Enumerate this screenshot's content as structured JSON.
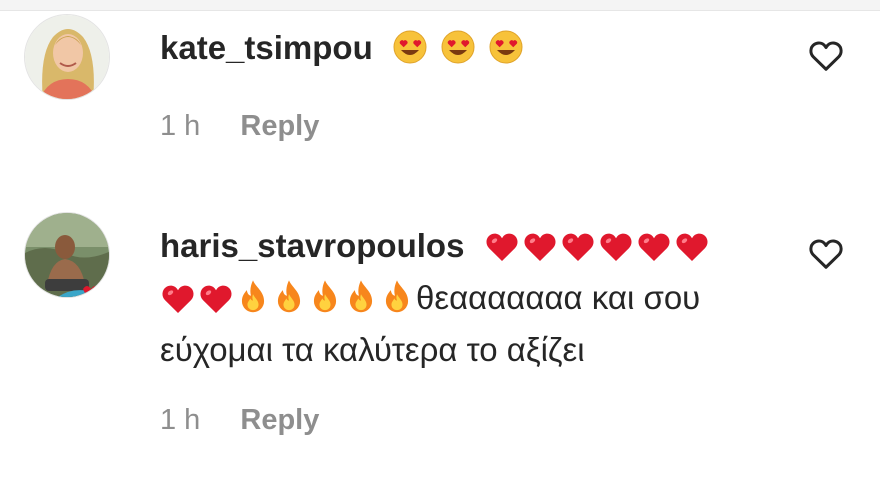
{
  "comments": [
    {
      "avatar": "avatar-woman-blonde",
      "username": "kate_tsimpou",
      "emojis": [
        "heart-eyes-emoji",
        "heart-eyes-emoji",
        "heart-eyes-emoji"
      ],
      "time": "1 h",
      "reply_label": "Reply",
      "like_icon": "heart-outline-icon"
    },
    {
      "avatar": "avatar-man-outdoors",
      "username": "haris_stavropoulos",
      "hearts_line1": 6,
      "hearts_line2": 2,
      "fires": 5,
      "text_line2": "θεααααααα και σου",
      "text_line3": "εύχομαι τα καλύτερα το αξίζει",
      "time": "1 h",
      "reply_label": "Reply",
      "like_icon": "heart-outline-icon"
    }
  ],
  "colors": {
    "text": "#262626",
    "muted": "#8e8e8e",
    "heart_red": "#e0182d",
    "fire_orange": "#f7861c",
    "emoji_yellow": "#f7c23a"
  }
}
